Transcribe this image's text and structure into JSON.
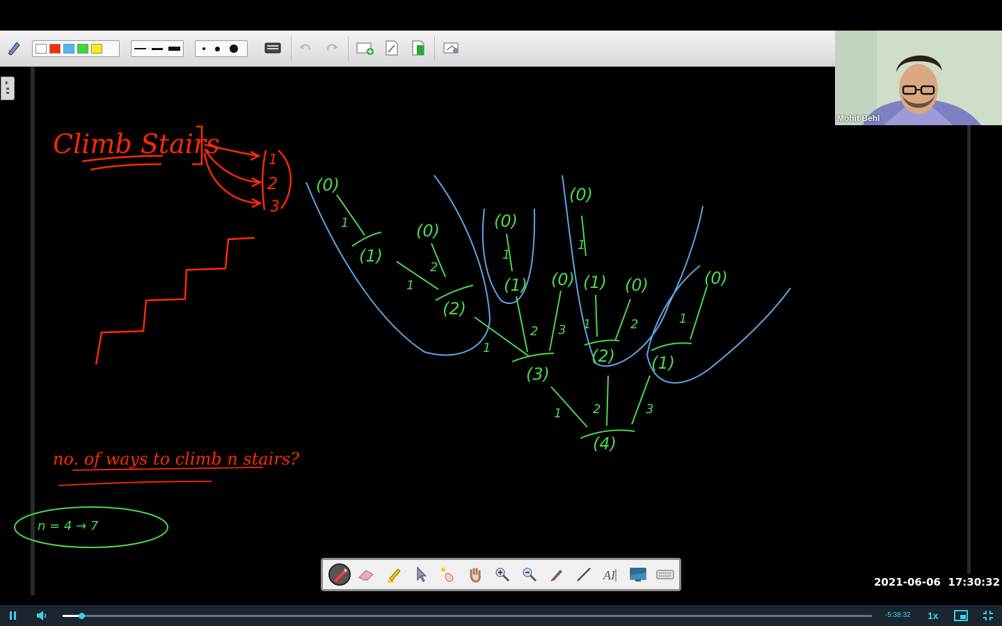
{
  "toolbar": {
    "colors": [
      "#ffffff",
      "#ff2a00",
      "#4db8ff",
      "#33dd33",
      "#ffee00"
    ],
    "tools": [
      "pen-icon",
      "color-palette",
      "line-width",
      "dot-size",
      "keyboard-icon",
      "undo-icon",
      "redo-icon",
      "new-page-icon",
      "page-icon",
      "page-color-icon",
      "settings-icon"
    ]
  },
  "webcam": {
    "name": "Mohit Behl"
  },
  "timestamp": "2021-06-06  17:30:32",
  "player": {
    "time_remaining": "-5:38:32",
    "speed": "1x",
    "progress": 0.023
  },
  "board": {
    "title": "Climb Stairs",
    "step_options": [
      "1",
      "2",
      "3"
    ],
    "question": "no. of ways to climb n stairs?",
    "example": "n = 4  →  7",
    "tree": {
      "root": "(4)",
      "nodes": [
        "(0)",
        "(1)",
        "(0)",
        "(2)",
        "(0)",
        "(1)",
        "(0)",
        "(3)",
        "(0)",
        "(1)",
        "(0)",
        "(2)",
        "(0)",
        "(1)"
      ],
      "edge_labels": [
        "1",
        "2",
        "3"
      ]
    }
  },
  "palette": {
    "tools": [
      "pen-icon",
      "eraser-icon",
      "highlighter-icon",
      "pointer-icon",
      "laser-icon",
      "hand-icon",
      "zoom-in-icon",
      "zoom-out-icon",
      "brush-icon",
      "line-icon",
      "text-icon",
      "screen-icon",
      "keyboard-icon"
    ]
  }
}
